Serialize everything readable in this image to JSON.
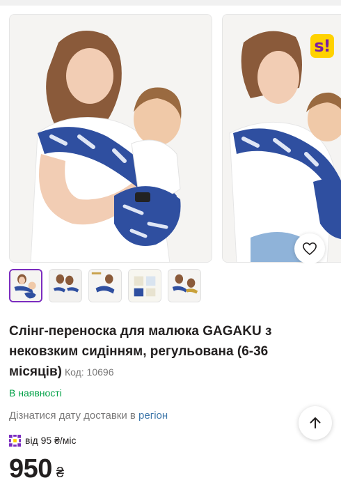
{
  "brand": {
    "badge": "s!",
    "colors": {
      "badge_bg": "#ffd200",
      "badge_fg": "#7b1fa2",
      "accent": "#7b2cbf",
      "success": "#00a046",
      "link": "#3e77aa"
    }
  },
  "gallery": {
    "images": [
      {
        "alt": "Слінг-переноска для малюка GAGAKU з нековзким сидінням"
      },
      {
        "alt": "Слінг-переноска GAGAKU, вигляд збоку"
      }
    ],
    "thumbnails": [
      {
        "alt": "Фото 1",
        "active": true
      },
      {
        "alt": "Фото 2",
        "active": false
      },
      {
        "alt": "Фото 3",
        "active": false
      },
      {
        "alt": "Фото 4",
        "active": false
      },
      {
        "alt": "Фото 5",
        "active": false
      }
    ],
    "wishlist_icon": "heart-icon"
  },
  "product": {
    "title": "Слінг-переноска для малюка GAGAKU з нековзким сидінням, регульована (6-36 місяців)",
    "code_label": "Код: 10696",
    "availability": "В наявності",
    "delivery_text": "Дізнатися дату доставки в",
    "delivery_link": "регіон",
    "installment_text": "від 95 ₴/міс",
    "price": "950",
    "currency": "₴"
  },
  "controls": {
    "scroll_top_icon": "arrow-up-icon"
  }
}
